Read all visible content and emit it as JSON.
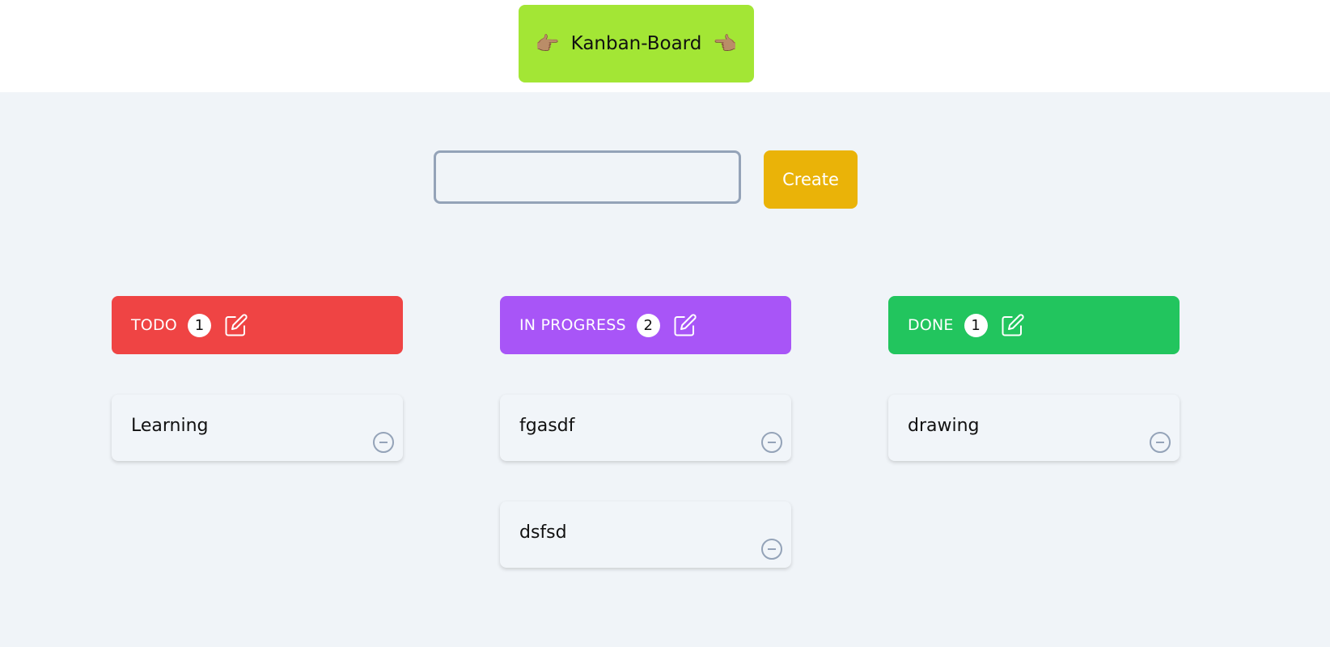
{
  "header": {
    "title": "Kanban-Board",
    "left_icon": "backhand-index-pointing-right-icon",
    "right_icon": "backhand-index-pointing-left-icon",
    "bar_color": "#a3e635"
  },
  "create_form": {
    "input_value": "",
    "input_placeholder": "",
    "button_label": "Create",
    "button_color": "#eab308"
  },
  "columns": [
    {
      "title": "TODO",
      "count": "1",
      "color": "#ef4444",
      "cards": [
        "Learning"
      ]
    },
    {
      "title": "IN PROGRESS",
      "count": "2",
      "color": "#a855f7",
      "cards": [
        "fgasdf",
        "dsfsd"
      ]
    },
    {
      "title": "DONE",
      "count": "1",
      "color": "#22c55e",
      "cards": [
        "drawing"
      ]
    }
  ]
}
